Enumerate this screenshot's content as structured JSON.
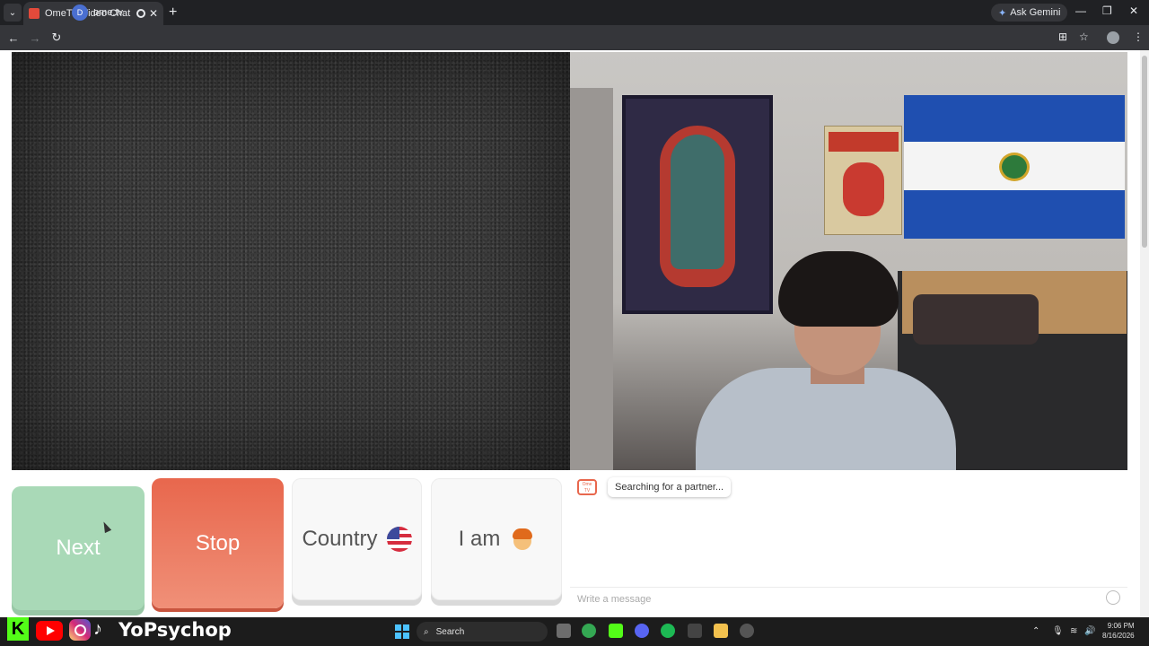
{
  "browser": {
    "tab_title": "OmeTV Video Chat — Ome",
    "url": "ome.tv",
    "site_badge": "D",
    "ask_gemini": "Ask Gemini",
    "new_tab": "+",
    "tab_close": "✕",
    "min": "—",
    "restore": "❐",
    "close": "✕",
    "back": "←",
    "forward": "→",
    "reload": "↻",
    "install": "⊞",
    "bookmark": "☆",
    "menu": "⋮"
  },
  "controls": {
    "next_label": "Next",
    "stop_label": "Stop",
    "country_label": "Country",
    "iam_label": "I am"
  },
  "chat": {
    "logo_text": "Ome TV",
    "status_message": "Searching for a partner...",
    "input_placeholder": "Write a message"
  },
  "overlay": {
    "kick_letter": "K",
    "tiktok_glyph": "♪",
    "handle": "YoPsychop"
  },
  "taskbar": {
    "search_label": "Search",
    "time": "9:06 PM",
    "date": "8/16/2026"
  },
  "colors": {
    "next": "#a9d9b7",
    "stop": "#e8674d",
    "kick": "#53fc18",
    "youtube": "#ff0000"
  }
}
